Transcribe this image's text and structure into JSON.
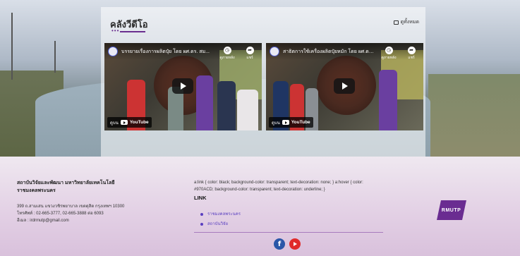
{
  "section": {
    "title": "คลังวีดีโอ",
    "see_all_label": "ดูทั้งหมด"
  },
  "videos": [
    {
      "title": "บรรยายเรื่องการผลิตปุ๋ย โดย ผศ.ดร. สม...",
      "watch_later": "ดูภายหลัง",
      "share": "แชร์",
      "watch_on": "ดูบน",
      "platform": "YouTube"
    },
    {
      "title": "สาธิตการใช้เครื่องผลิตปุ๋ยหมัก โดย ผศ.ดร...",
      "watch_later": "ดูภายหลัง",
      "share": "แชร์",
      "watch_on": "ดูบน",
      "platform": "YouTube"
    }
  ],
  "footer": {
    "org_name_line1": "สถาบันวิจัยและพัฒนา มหาวิทยาลัยเทคโนโลยี",
    "org_name_line2": "ราชมงคลพระนคร",
    "address": "399 ถ.สามเสน แขวงวชิรพยาบาล เขตดุสิต กรุงเทพฯ 10300",
    "phone": "โทรศัพท์ : 02-665-3777, 02-665-3888 ต่อ 6093",
    "email": "อีเมล : irdrmutp@gmail.com",
    "css_note": "a:link { color: black; background-color: transparent; text-decoration: none; } a:hover { color: #970ACD; background-color: transparent; text-decoration: underline; }",
    "links_heading": "LINK",
    "links": [
      "ราชมงคลพระนคร",
      "สถาบันวิจัย"
    ],
    "logo_text": "RMUTP"
  },
  "colors": {
    "brand_purple": "#6a2c91",
    "link_blue": "#5a3fc0",
    "facebook": "#2a57a8",
    "youtube": "#e02b2b"
  }
}
